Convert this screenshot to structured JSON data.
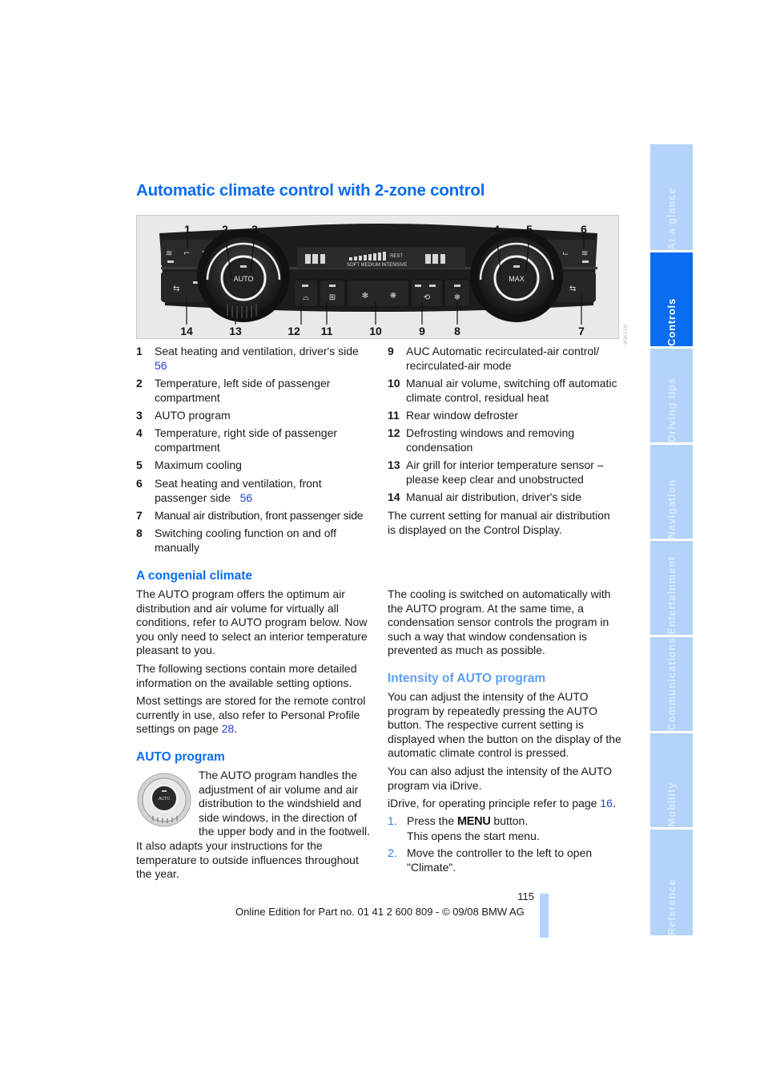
{
  "page": {
    "title": "Automatic climate control with 2-zone control",
    "page_number": "115",
    "footer": "Online Edition for Part no. 01 41 2 600 809 - © 09/08 BMW AG"
  },
  "figure": {
    "description": "Automatic climate control panel, 2-zone",
    "callouts_top": [
      "1",
      "2",
      "3",
      "4",
      "5",
      "6"
    ],
    "callouts_bottom": [
      "14",
      "13",
      "12",
      "11",
      "10",
      "9",
      "8",
      "7"
    ],
    "knob_left_label": "AUTO",
    "knob_right_label": "MAX",
    "display_text": "SOFT  MEDIUM  INTENSIVE",
    "display_rest": "REST",
    "figure_code": "W0K2JW"
  },
  "legend_left": [
    {
      "num": "1",
      "text": "Seat heating and ventilation, driver's side",
      "link": "56"
    },
    {
      "num": "2",
      "text": "Temperature, left side of passenger compartment"
    },
    {
      "num": "3",
      "text": "AUTO program"
    },
    {
      "num": "4",
      "text": "Temperature, right side of passenger compartment"
    },
    {
      "num": "5",
      "text": "Maximum cooling"
    },
    {
      "num": "6",
      "text": "Seat heating and ventilation, front passenger side",
      "link": "56"
    },
    {
      "num": "7",
      "text": "Manual air distribution, front passenger side"
    },
    {
      "num": "8",
      "text": "Switching cooling function on and off manually"
    }
  ],
  "legend_right": [
    {
      "num": "9",
      "text": "AUC Automatic recirculated-air control/ recirculated-air mode"
    },
    {
      "num": "10",
      "text": "Manual air volume, switching off automatic climate control, residual heat"
    },
    {
      "num": "11",
      "text": "Rear window defroster"
    },
    {
      "num": "12",
      "text": "Defrosting windows and removing condensation"
    },
    {
      "num": "13",
      "text": "Air grill for interior temperature sensor – please keep clear and unobstructed"
    },
    {
      "num": "14",
      "text": "Manual air distribution, driver's side"
    }
  ],
  "legend_note": "The current setting for manual air distribution is displayed on the Control Display.",
  "sections": {
    "congenial": {
      "heading": "A congenial climate",
      "p1": "The AUTO program offers the optimum air distribution and air volume for virtually all conditions, refer to AUTO program below. Now you only need to select an interior temperature pleasant to you.",
      "p2": "The following sections contain more detailed information on the available setting options.",
      "p3_before": "Most settings are stored for the remote control currently in use, also refer to Personal Profile settings on page ",
      "p3_link": "28",
      "p3_after": "."
    },
    "auto_program": {
      "heading": "AUTO program",
      "p1": "The AUTO program handles the adjustment of air volume and air distribution to the windshield and side windows, in the direction of the upper body and in the footwell.",
      "p2": "It also adapts your instructions for the temperature to outside influences throughout the year."
    },
    "cooling": {
      "p1": "The cooling is switched on automatically with the AUTO program. At the same time, a condensation sensor controls the program in such a way that window condensation is prevented as much as possible."
    },
    "intensity": {
      "heading": "Intensity of AUTO program",
      "p1": "You can adjust the intensity of the AUTO program by repeatedly pressing the AUTO button. The respective current setting is displayed when the button on the display of the automatic climate control is pressed.",
      "p2": "You can also adjust the intensity of the AUTO program via iDrive.",
      "p3_before": "iDrive, for operating principle refer to page ",
      "p3_link": "16",
      "p3_after": ".",
      "steps": [
        {
          "num": "1.",
          "before": "Press the ",
          "key": "MENU",
          "after": " button.",
          "sub": "This opens the start menu."
        },
        {
          "num": "2.",
          "text": "Move the controller to the left to open \"Climate\"."
        }
      ]
    }
  },
  "sidebar": {
    "tabs": [
      {
        "label": "At a glance",
        "active": false
      },
      {
        "label": "Controls",
        "active": true
      },
      {
        "label": "Driving tips",
        "active": false
      },
      {
        "label": "Navigation",
        "active": false
      },
      {
        "label": "Entertainment",
        "active": false
      },
      {
        "label": "Communications",
        "active": false
      },
      {
        "label": "Mobility",
        "active": false
      },
      {
        "label": "Reference",
        "active": false
      }
    ]
  },
  "colors": {
    "heading_blue": "#0a6cf0",
    "subheading_blue": "#5ea0f5",
    "link_blue": "#1f3fd6",
    "tab_inactive": "#b3d3fb",
    "tab_active": "#0a6cf0"
  }
}
